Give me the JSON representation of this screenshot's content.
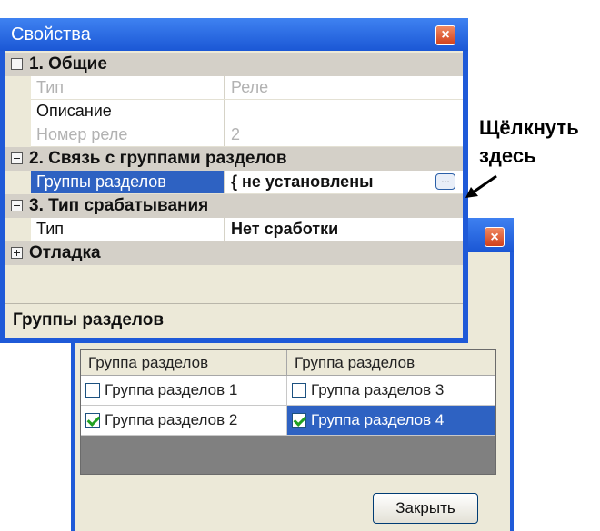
{
  "properties_window": {
    "title": "Свойства",
    "close_glyph": "×",
    "categories": [
      {
        "label": "1. Общие",
        "expanded": true,
        "rows": [
          {
            "name": "Тип",
            "value": "Реле",
            "disabled": true
          },
          {
            "name": "Описание",
            "value": "",
            "disabled": false
          },
          {
            "name": "Номер реле",
            "value": "2",
            "disabled": true
          }
        ]
      },
      {
        "label": "2. Связь с группами разделов",
        "expanded": true,
        "rows": [
          {
            "name": "Группы разделов",
            "value": "{ не установлены",
            "selected": true,
            "ellipsis": "..."
          }
        ]
      },
      {
        "label": "3. Тип срабатывания",
        "expanded": true,
        "rows": [
          {
            "name": "Тип",
            "value": "Нет сработки"
          }
        ]
      },
      {
        "label": "Отладка",
        "expanded": false,
        "rows": []
      }
    ],
    "description": "Группы разделов"
  },
  "callout": {
    "line1": "Щёлкнуть",
    "line2": "здесь"
  },
  "groups_dialog": {
    "close_glyph": "×",
    "headers": [
      "Группа разделов",
      "Группа разделов"
    ],
    "items": [
      {
        "label": "Группа разделов 1",
        "checked": false,
        "selected": false
      },
      {
        "label": "Группа разделов 3",
        "checked": false,
        "selected": false
      },
      {
        "label": "Группа разделов 2",
        "checked": true,
        "selected": false
      },
      {
        "label": "Группа разделов 4",
        "checked": true,
        "selected": true
      }
    ],
    "close_button": "Закрыть"
  },
  "colors": {
    "title_bar": "#1f5ad8",
    "selection": "#2e62c2",
    "category_bg": "#d4d0c8",
    "dialog_bg": "#ece9d8",
    "checkmark": "#21a121"
  }
}
